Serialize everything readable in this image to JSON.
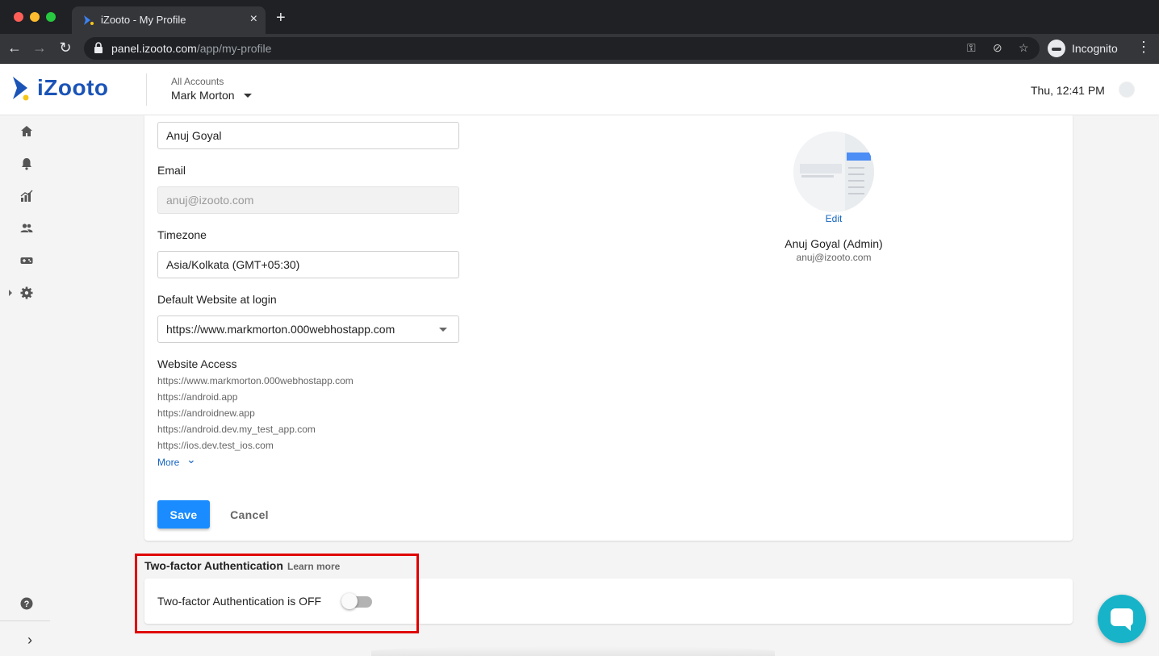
{
  "browser": {
    "tab_title": "iZooto - My Profile",
    "url_host": "panel.izooto.com",
    "url_path": "/app/my-profile",
    "incognito_label": "Incognito"
  },
  "header": {
    "logo_text": "iZooto",
    "account_label": "All Accounts",
    "account_name": "Mark Morton",
    "clock": "Thu, 12:41 PM"
  },
  "form": {
    "name_value": "Anuj Goyal",
    "email_label": "Email",
    "email_value": "anuj@izooto.com",
    "timezone_label": "Timezone",
    "timezone_value": "Asia/Kolkata (GMT+05:30)",
    "default_site_label": "Default Website at login",
    "default_site_value": "https://www.markmorton.000webhostapp.com",
    "access_label": "Website Access",
    "access_items": [
      "https://www.markmorton.000webhostapp.com",
      "https://android.app",
      "https://androidnew.app",
      "https://android.dev.my_test_app.com",
      "https://ios.dev.test_ios.com"
    ],
    "more_label": "More",
    "save_label": "Save",
    "cancel_label": "Cancel"
  },
  "profile": {
    "edit_label": "Edit",
    "name": "Anuj Goyal (Admin)",
    "email": "anuj@izooto.com"
  },
  "tfa": {
    "title": "Two-factor Authentication",
    "learn_more": "Learn more",
    "status": "Two-factor Authentication is OFF",
    "enabled": false
  },
  "colors": {
    "brand": "#1b54b7",
    "primary_button": "#1a8cff",
    "link": "#1565c0",
    "highlight": "#e00000",
    "chat": "#17b4c9"
  }
}
